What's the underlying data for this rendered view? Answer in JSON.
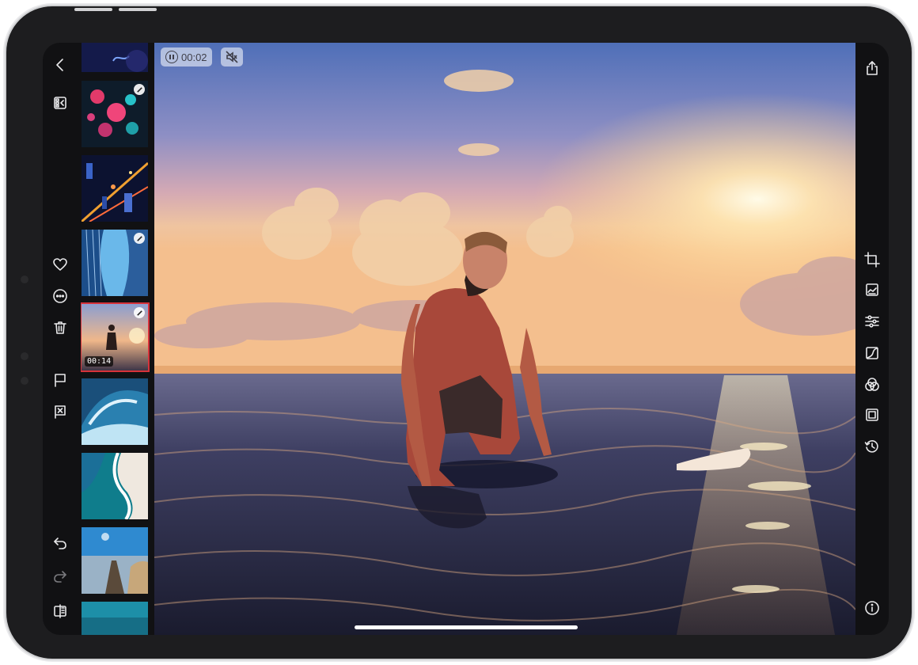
{
  "video": {
    "elapsed": "00:02"
  },
  "thumbnails": [
    {
      "label": "jellyfish",
      "edited": false,
      "duration": ""
    },
    {
      "label": "jellyfish-pink",
      "edited": true,
      "duration": ""
    },
    {
      "label": "city-night",
      "edited": false,
      "duration": ""
    },
    {
      "label": "tower",
      "edited": true,
      "duration": ""
    },
    {
      "label": "surfer-sunset",
      "edited": true,
      "duration": "00:14",
      "selected": true
    },
    {
      "label": "wave",
      "edited": false,
      "duration": ""
    },
    {
      "label": "beach-aerial",
      "edited": false,
      "duration": ""
    },
    {
      "label": "pier",
      "edited": false,
      "duration": ""
    },
    {
      "label": "ocean",
      "edited": false,
      "duration": ""
    }
  ],
  "left_tools": [
    "back-icon",
    "browser-icon",
    "heart-icon",
    "more-icon",
    "trash-icon",
    "flag-icon",
    "flag-x-icon",
    "undo-icon",
    "redo-icon",
    "compare-icon"
  ],
  "right_tools": [
    "share-icon",
    "crop-icon",
    "adjust-image-icon",
    "sliders-icon",
    "curves-icon",
    "color-mix-icon",
    "frame-icon",
    "history-icon",
    "info-icon"
  ],
  "colors": {
    "accent_selection": "#d6323a",
    "device_frame": "#1d1d1f",
    "toolbar_icon": "#e8e8ea"
  }
}
